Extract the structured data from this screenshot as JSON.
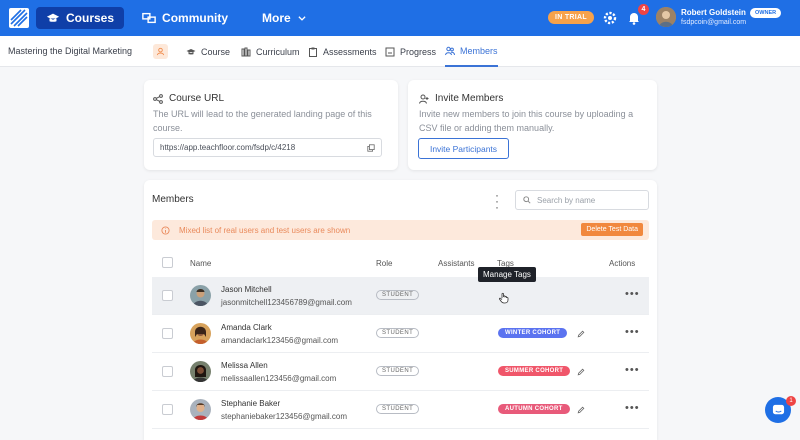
{
  "topbar": {
    "nav": [
      {
        "label": "Courses",
        "icon": "graduation-cap-icon"
      },
      {
        "label": "Community",
        "icon": "community-icon"
      },
      {
        "label": "More",
        "icon": "chevron-down-icon"
      }
    ],
    "trial_label": "IN TRIAL",
    "notification_count": "4",
    "user": {
      "name": "Robert Goldstein",
      "email": "fsdpcoin@gmail.com",
      "role_badge": "OWNER"
    }
  },
  "subnav": {
    "course_title": "Mastering the Digital Marketing",
    "tabs": [
      {
        "label": "Course"
      },
      {
        "label": "Curriculum"
      },
      {
        "label": "Assessments"
      },
      {
        "label": "Progress"
      },
      {
        "label": "Members"
      }
    ]
  },
  "course_url": {
    "title": "Course URL",
    "description": "The URL will lead to the generated landing page of this course.",
    "url": "https://app.teachfloor.com/fsdp/c/4218"
  },
  "invite": {
    "title": "Invite Members",
    "description": "Invite new members to join this course by uploading a CSV file or adding them manually.",
    "button_label": "Invite Participants"
  },
  "members": {
    "title": "Members",
    "search_placeholder": "Search by name",
    "notice": "Mixed list of real users and test users are shown",
    "delete_button": "Delete Test Data",
    "columns": {
      "name": "Name",
      "role": "Role",
      "assistants": "Assistants",
      "tags": "Tags",
      "actions": "Actions"
    },
    "tooltip": "Manage Tags",
    "rows": [
      {
        "name": "Jason Mitchell",
        "email": "jasonmitchell123456789@gmail.com",
        "role": "STUDENT",
        "tag": ""
      },
      {
        "name": "Amanda Clark",
        "email": "amandaclark123456@gmail.com",
        "role": "STUDENT",
        "tag": "WINTER COHORT"
      },
      {
        "name": "Melissa Allen",
        "email": "melissaallen123456@gmail.com",
        "role": "STUDENT",
        "tag": "SUMMER COHORT"
      },
      {
        "name": "Stephanie Baker",
        "email": "stephaniebaker123456@gmail.com",
        "role": "STUDENT",
        "tag": "AUTUMN COHORT"
      }
    ]
  },
  "chat_badge": "1",
  "colors": {
    "brand": "#1f6fe5",
    "winter": "#5b73f0",
    "summer": "#f0566a",
    "autumn": "#e85a7a",
    "accent_orange": "#f1883e"
  }
}
